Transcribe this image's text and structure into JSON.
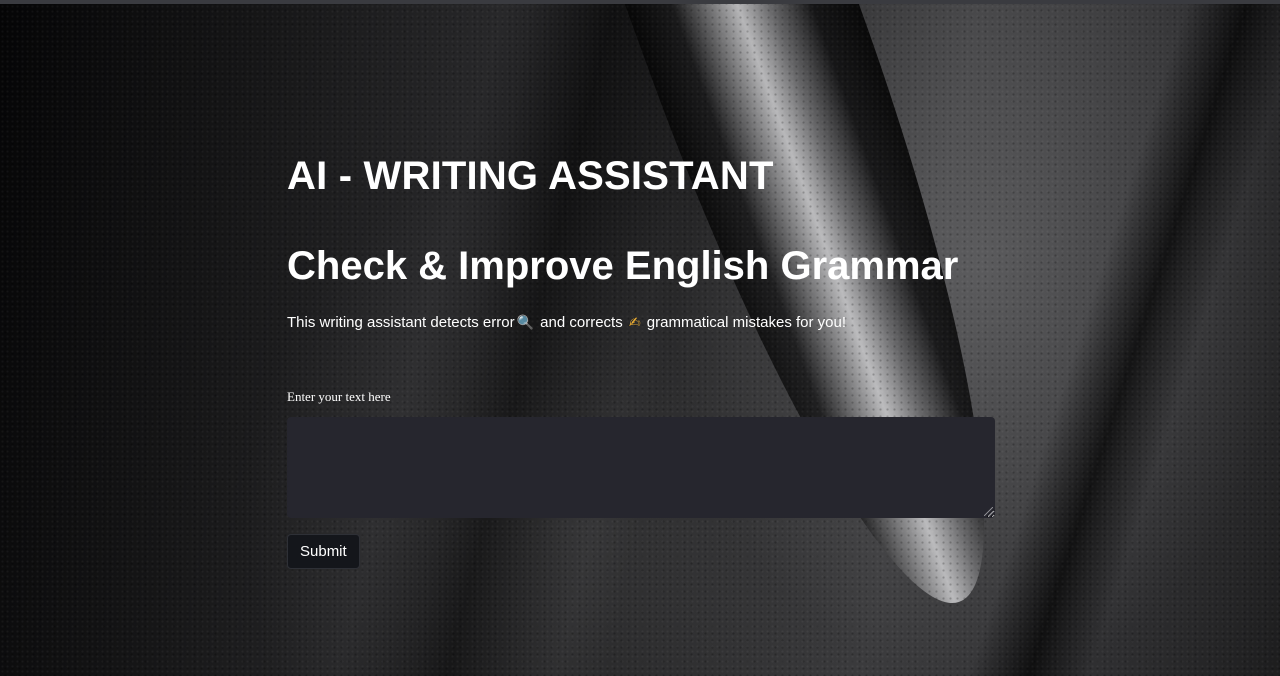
{
  "header": {
    "app_title": "AI - WRITING ASSISTANT",
    "subtitle": "Check & Improve English Grammar"
  },
  "description": {
    "part1": "This writing assistant detects error",
    "icon1": "magnifying-glass-icon",
    "part2": " and corrects ",
    "icon2": "writing-hand-icon",
    "part3": " grammatical mistakes for you!"
  },
  "form": {
    "textarea_label": "Enter your text here",
    "textarea_value": "",
    "submit_label": "Submit"
  },
  "colors": {
    "text": "#ffffff",
    "input_bg": "#26262e",
    "button_bg": "#14161b"
  }
}
